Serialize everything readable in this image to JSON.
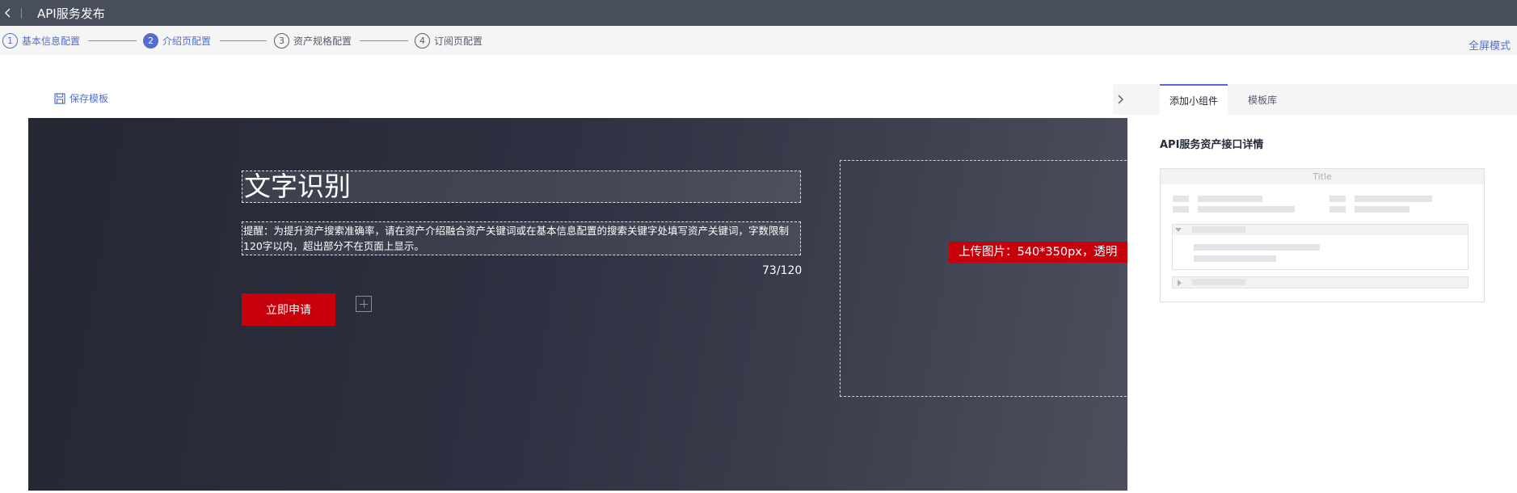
{
  "header": {
    "title": "API服务发布"
  },
  "steps": [
    {
      "num": "1",
      "label": "基本信息配置"
    },
    {
      "num": "2",
      "label": "介绍页配置"
    },
    {
      "num": "3",
      "label": "资产规格配置"
    },
    {
      "num": "4",
      "label": "订阅页配置"
    }
  ],
  "toolbar": {
    "fullscreen_label": "全屏模式",
    "save_template_label": "保存模板"
  },
  "hero": {
    "title": "文字识别",
    "description": "提醒：为提升资产搜索准确率，请在资产介绍融合资产关键词或在基本信息配置的搜索关键字处填写资产关键词，字数限制120字以内，超出部分不在页面上显示。",
    "char_count": "73/120",
    "apply_label": "立即申请",
    "upload_hint": "上传图片：540*350px，透明"
  },
  "panel": {
    "tabs": [
      "添加小组件",
      "模板库"
    ],
    "heading": "API服务资产接口详情",
    "widget_title": "Title"
  },
  "colors": {
    "accent": "#526ecc",
    "brand_red": "#c7000b",
    "header_bg": "#494e5c"
  },
  "icons": [
    "back-icon",
    "save-icon",
    "plus-icon",
    "chevron-right-icon",
    "triangle-down-icon",
    "triangle-right-icon"
  ]
}
